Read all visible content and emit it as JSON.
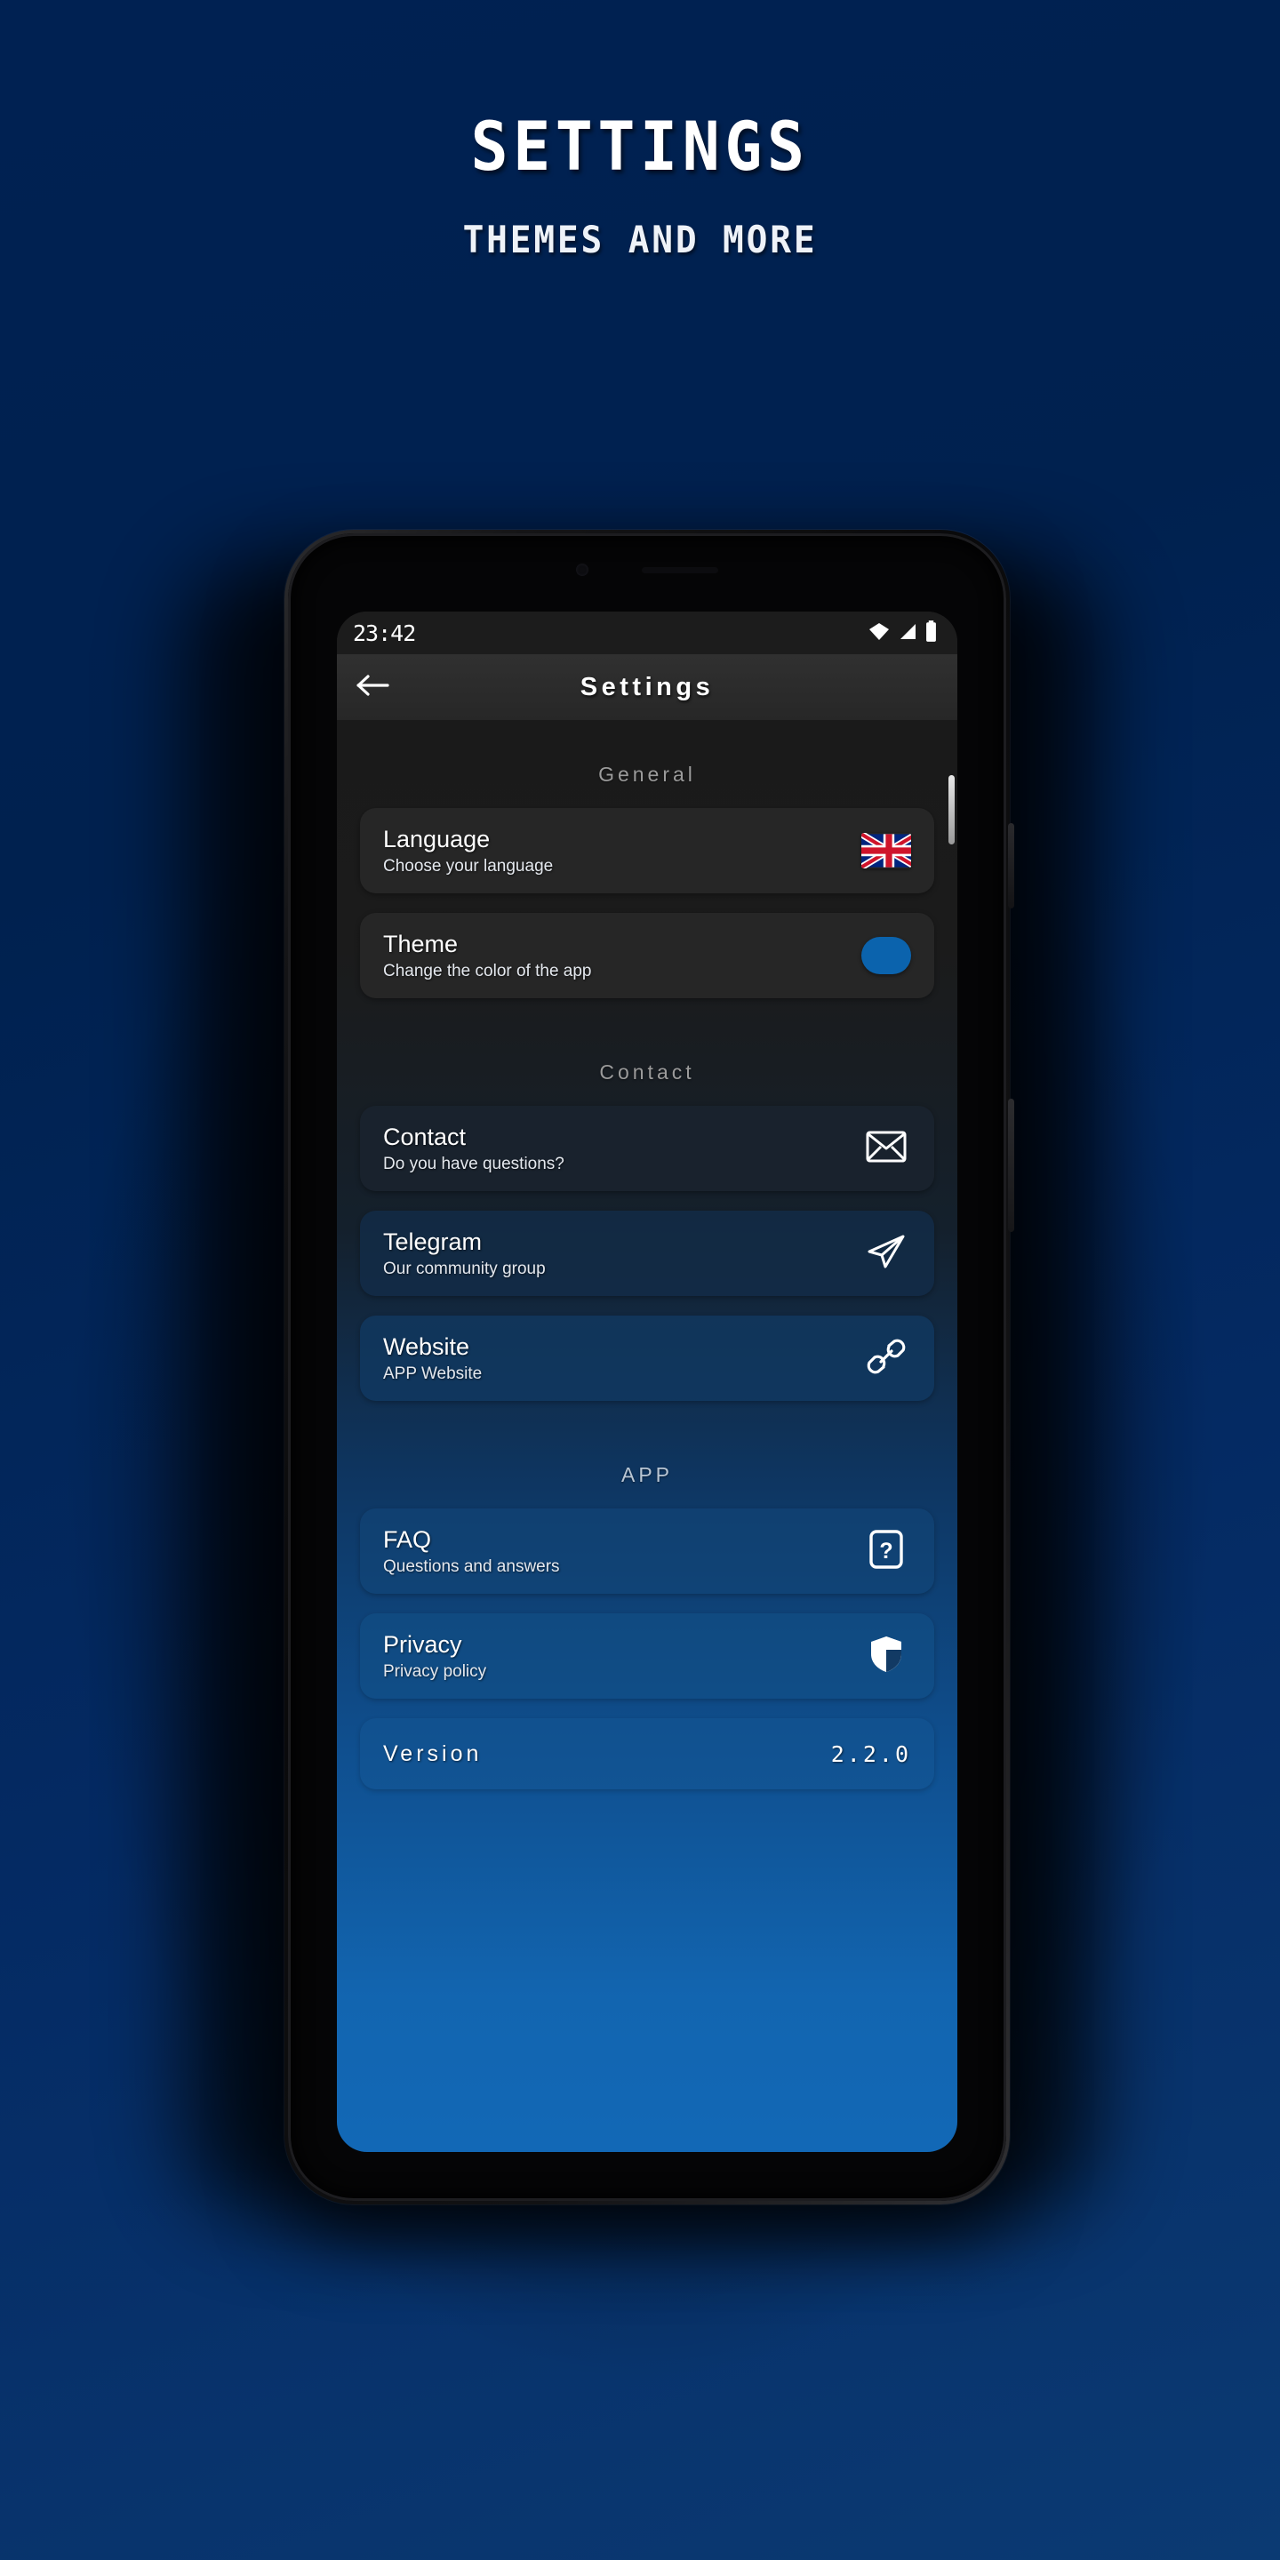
{
  "promo": {
    "title": "SETTINGS",
    "subtitle": "THEMES AND MORE"
  },
  "statusbar": {
    "time": "23:42",
    "icons": [
      "wifi-icon",
      "cellular-signal-icon",
      "battery-icon"
    ]
  },
  "appbar": {
    "title": "Settings",
    "back_icon": "arrow-left-icon"
  },
  "colors": {
    "accent": "#0b63ad",
    "page_bg_top": "#002152",
    "page_bg_bottom": "#0b3a73",
    "screen_bottom": "#1268b6",
    "card_dark": "#262626",
    "section_label": "#9b9b9b"
  },
  "sections": [
    {
      "label": "General",
      "rows": [
        {
          "title": "Language",
          "subtitle": "Choose your language",
          "icon": "uk-flag-icon",
          "trailing_type": "flag"
        },
        {
          "title": "Theme",
          "subtitle": "Change the color of the app",
          "icon": "color-swatch-icon",
          "trailing_type": "swatch"
        }
      ]
    },
    {
      "label": "Contact",
      "rows": [
        {
          "title": "Contact",
          "subtitle": "Do you have questions?",
          "icon": "envelope-icon",
          "trailing_type": "icon"
        },
        {
          "title": "Telegram",
          "subtitle": "Our community group",
          "icon": "paper-plane-icon",
          "trailing_type": "icon"
        },
        {
          "title": "Website",
          "subtitle": "APP Website",
          "icon": "link-chain-icon",
          "trailing_type": "icon"
        }
      ]
    },
    {
      "label": "APP",
      "rows": [
        {
          "title": "FAQ",
          "subtitle": "Questions and answers",
          "icon": "question-mark-box-icon",
          "trailing_type": "icon"
        },
        {
          "title": "Privacy",
          "subtitle": "Privacy policy",
          "icon": "shield-icon",
          "trailing_type": "icon"
        }
      ]
    }
  ],
  "version_row": {
    "label": "Version",
    "value": "2.2.0"
  }
}
